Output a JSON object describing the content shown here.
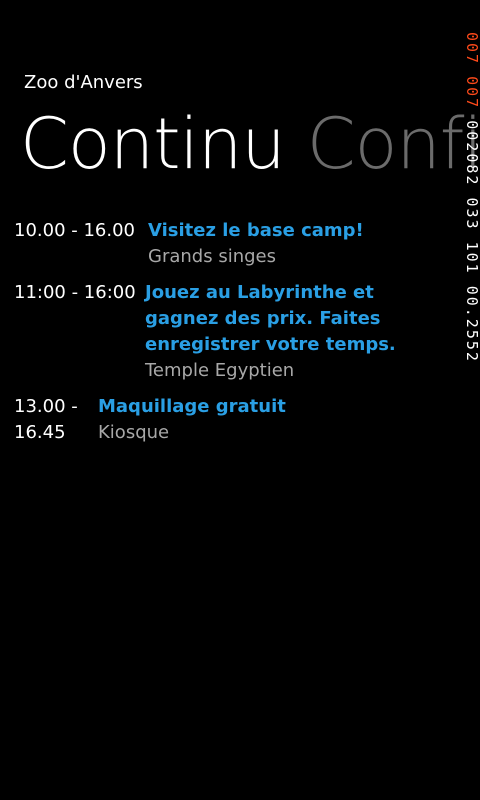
{
  "app": {
    "title": "Zoo d'Anvers"
  },
  "pivot": {
    "active": "Continu",
    "next": "Config"
  },
  "debug_counter": {
    "part1": "007 007",
    "part2": " 002082 033 101 00.2552"
  },
  "schedule": [
    {
      "time": "10.00 - 16.00",
      "title": "Visitez le base camp!",
      "location": "Grands singes"
    },
    {
      "time": "11:00 - 16:00",
      "title": "Jouez au Labyrinthe et gagnez des prix. Faites enregistrer votre temps.",
      "location": "Temple Egyptien"
    },
    {
      "time": "13.00 - 16.45",
      "title": "Maquillage gratuit",
      "location": "Kiosque"
    }
  ],
  "colors": {
    "accent": "#2a9fe4",
    "background": "#000000",
    "secondary_text": "#a8a8a8",
    "inactive_pivot": "#6b6b6b",
    "counter_red": "#ff4a1a"
  }
}
